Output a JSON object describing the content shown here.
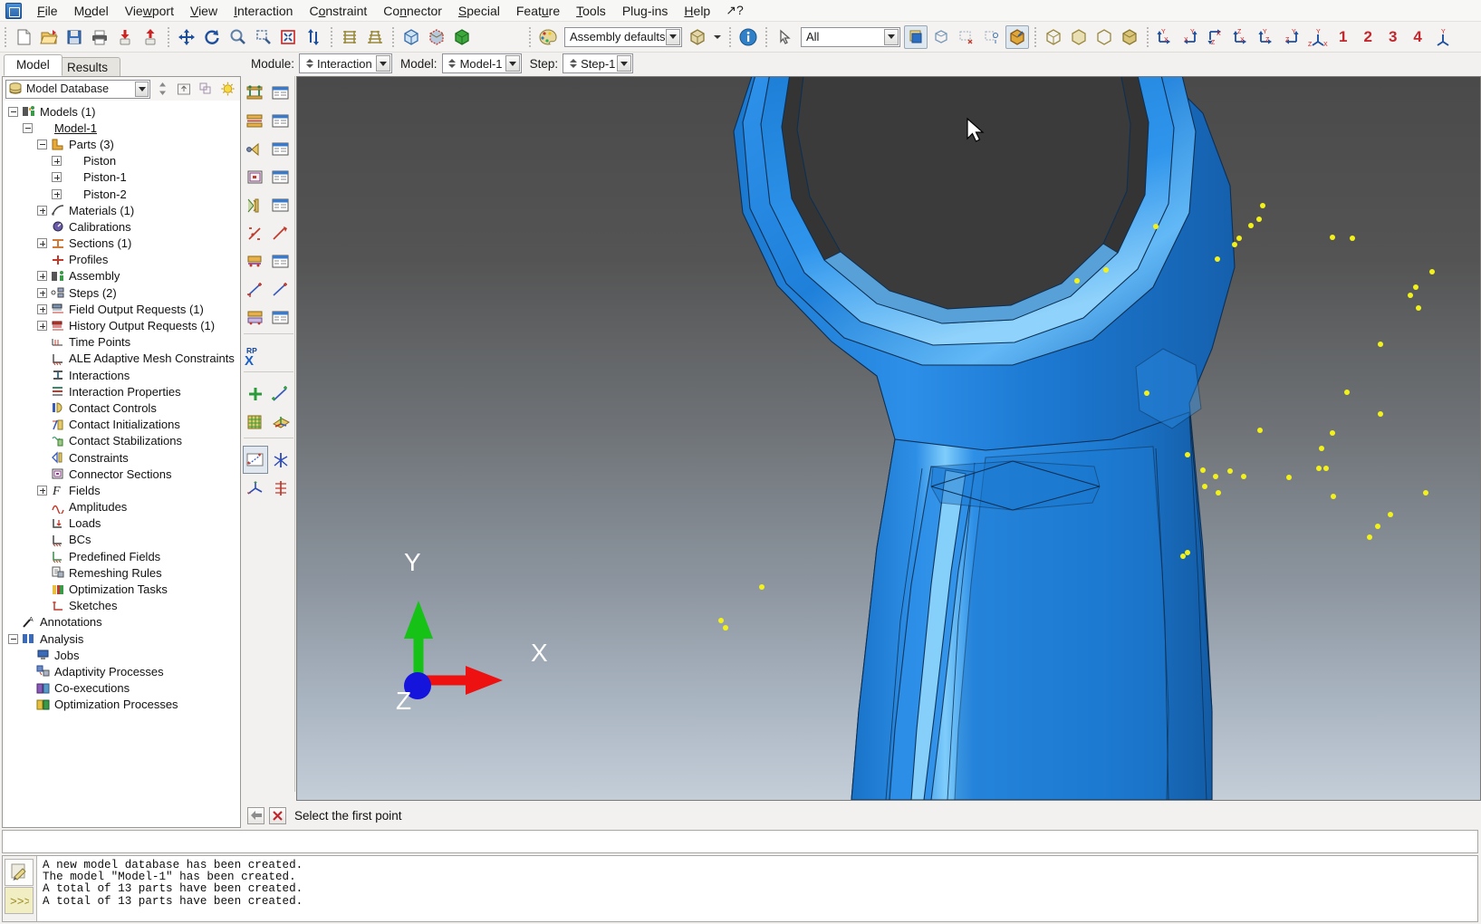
{
  "window": {
    "app_icon": "abaqus-cae-icon"
  },
  "menubar": {
    "items": [
      {
        "label": "File",
        "mnemonic": "F"
      },
      {
        "label": "Model",
        "mnemonic": "M"
      },
      {
        "label": "Viewport",
        "mnemonic": "w"
      },
      {
        "label": "View",
        "mnemonic": "V"
      },
      {
        "label": "Interaction",
        "mnemonic": "I"
      },
      {
        "label": "Constraint",
        "mnemonic": "o"
      },
      {
        "label": "Connector",
        "mnemonic": "n"
      },
      {
        "label": "Special",
        "mnemonic": "S"
      },
      {
        "label": "Feature",
        "mnemonic": "u"
      },
      {
        "label": "Tools",
        "mnemonic": "T"
      },
      {
        "label": "Plug-ins",
        "mnemonic": "g"
      },
      {
        "label": "Help",
        "mnemonic": "H"
      }
    ],
    "help_cursor": "context-help-icon"
  },
  "toolbar": {
    "file_group": [
      "new-file-icon",
      "open-file-icon",
      "save-icon",
      "print-icon",
      "import-icon",
      "export-icon"
    ],
    "view_group": [
      "pan-icon",
      "rotate-icon",
      "magnify-icon",
      "zoom-box-icon",
      "fit-all-icon",
      "auto-fit-icon"
    ],
    "render_group": [
      "wireframe-icon",
      "hidden-line-icon"
    ],
    "shade_group": [
      "shaded-cube-icon",
      "render-style-icon",
      "filled-cube-icon"
    ],
    "color_label": "Assembly defaults",
    "color_icon": "color-palette-icon",
    "color_cube_icon": "color-code-cube-icon",
    "info_icon": "info-icon",
    "select_arrow_icon": "selection-arrow-icon",
    "filter_value": "All",
    "display_group": [
      "display-group-icon",
      "replace-group-icon",
      "remove-selected-icon",
      "add-selected-icon",
      "reset-group-icon"
    ],
    "part_group": [
      "part-cube-icon",
      "instance-cube-icon",
      "assembly-cube-icon",
      "highlight-cube-icon"
    ],
    "view_cube_group": [
      "view-xy-icon",
      "view-yx-icon",
      "view-zx-icon",
      "view-zx2-icon",
      "view-yz-icon",
      "view-zy-icon",
      "iso-view-icon"
    ],
    "view_numbers": [
      "1",
      "2",
      "3",
      "4"
    ],
    "last_icon": "apply-view-icon"
  },
  "left_panel": {
    "tabs": [
      {
        "label": "Model",
        "active": true
      },
      {
        "label": "Results",
        "active": false
      }
    ],
    "database_selector": {
      "value": "Model Database",
      "icon": "database-icon"
    },
    "tools": [
      "sort-icon",
      "up-level-icon",
      "filter-icon",
      "highlight-bulb-icon"
    ]
  },
  "tree": {
    "items": [
      {
        "depth": 0,
        "exp": "minus",
        "icon": "models-icon",
        "label": "Models (1)"
      },
      {
        "depth": 1,
        "exp": "minus",
        "icon": "none",
        "label": "Model-1",
        "underline": true
      },
      {
        "depth": 2,
        "exp": "minus",
        "icon": "parts-icon",
        "label": "Parts (3)"
      },
      {
        "depth": 3,
        "exp": "plus",
        "icon": "none",
        "label": "Piston"
      },
      {
        "depth": 3,
        "exp": "plus",
        "icon": "none",
        "label": "Piston-1"
      },
      {
        "depth": 3,
        "exp": "plus",
        "icon": "none",
        "label": "Piston-2"
      },
      {
        "depth": 2,
        "exp": "plus",
        "icon": "materials-icon",
        "label": "Materials (1)"
      },
      {
        "depth": 2,
        "exp": "leaf",
        "icon": "calibrations-icon",
        "label": "Calibrations"
      },
      {
        "depth": 2,
        "exp": "plus",
        "icon": "sections-icon",
        "label": "Sections (1)"
      },
      {
        "depth": 2,
        "exp": "leaf",
        "icon": "profiles-icon",
        "label": "Profiles"
      },
      {
        "depth": 2,
        "exp": "plus",
        "icon": "assembly-icon",
        "label": "Assembly"
      },
      {
        "depth": 2,
        "exp": "plus",
        "icon": "steps-icon",
        "label": "Steps (2)"
      },
      {
        "depth": 2,
        "exp": "plus",
        "icon": "field-output-icon",
        "label": "Field Output Requests (1)"
      },
      {
        "depth": 2,
        "exp": "plus",
        "icon": "history-output-icon",
        "label": "History Output Requests (1)"
      },
      {
        "depth": 2,
        "exp": "leaf",
        "icon": "time-points-icon",
        "label": "Time Points"
      },
      {
        "depth": 2,
        "exp": "leaf",
        "icon": "ale-mesh-icon",
        "label": "ALE Adaptive Mesh Constraints"
      },
      {
        "depth": 2,
        "exp": "leaf",
        "icon": "interactions-icon",
        "label": "Interactions"
      },
      {
        "depth": 2,
        "exp": "leaf",
        "icon": "interaction-props-icon",
        "label": "Interaction Properties"
      },
      {
        "depth": 2,
        "exp": "leaf",
        "icon": "contact-controls-icon",
        "label": "Contact Controls"
      },
      {
        "depth": 2,
        "exp": "leaf",
        "icon": "contact-init-icon",
        "label": "Contact Initializations"
      },
      {
        "depth": 2,
        "exp": "leaf",
        "icon": "contact-stab-icon",
        "label": "Contact Stabilizations"
      },
      {
        "depth": 2,
        "exp": "leaf",
        "icon": "constraints-icon",
        "label": "Constraints"
      },
      {
        "depth": 2,
        "exp": "leaf",
        "icon": "connector-sections-icon",
        "label": "Connector Sections"
      },
      {
        "depth": 2,
        "exp": "plus",
        "icon": "fields-icon",
        "label": "Fields"
      },
      {
        "depth": 2,
        "exp": "leaf",
        "icon": "amplitudes-icon",
        "label": "Amplitudes"
      },
      {
        "depth": 2,
        "exp": "leaf",
        "icon": "loads-icon",
        "label": "Loads"
      },
      {
        "depth": 2,
        "exp": "leaf",
        "icon": "bcs-icon",
        "label": "BCs"
      },
      {
        "depth": 2,
        "exp": "leaf",
        "icon": "predefined-fields-icon",
        "label": "Predefined Fields"
      },
      {
        "depth": 2,
        "exp": "leaf",
        "icon": "remeshing-rules-icon",
        "label": "Remeshing Rules"
      },
      {
        "depth": 2,
        "exp": "leaf",
        "icon": "optimization-tasks-icon",
        "label": "Optimization Tasks"
      },
      {
        "depth": 2,
        "exp": "leaf",
        "icon": "sketches-icon",
        "label": "Sketches"
      },
      {
        "depth": 0,
        "exp": "leaf",
        "icon": "annotations-icon",
        "label": "Annotations"
      },
      {
        "depth": 0,
        "exp": "minus",
        "icon": "analysis-icon",
        "label": "Analysis"
      },
      {
        "depth": 1,
        "exp": "leaf",
        "icon": "jobs-icon",
        "label": "Jobs"
      },
      {
        "depth": 1,
        "exp": "leaf",
        "icon": "adaptivity-icon",
        "label": "Adaptivity Processes"
      },
      {
        "depth": 1,
        "exp": "leaf",
        "icon": "coexecutions-icon",
        "label": "Co-executions"
      },
      {
        "depth": 1,
        "exp": "leaf",
        "icon": "optimization-proc-icon",
        "label": "Optimization Processes"
      }
    ]
  },
  "context_bar": {
    "module_label": "Module:",
    "module_value": "Interaction",
    "model_label": "Model:",
    "model_value": "Model-1",
    "step_label": "Step:",
    "step_value": "Step-1"
  },
  "toolbox": {
    "items": [
      "create-interaction-icon",
      "interaction-manager-icon",
      "create-interaction-property-icon",
      "interaction-property-manager-icon",
      "create-constraint-icon",
      "constraint-manager-icon",
      "create-connector-section-icon",
      "connector-section-manager-icon",
      "create-contact-control-icon",
      "contact-control-manager-icon",
      "create-contact-initialization-icon",
      "contact-initialization-manager-icon",
      "create-contact-stabilization-icon",
      "contact-stabilization-manager-icon",
      "create-wire-feature-icon",
      "edit-wire-feature-icon",
      "find-contact-pairs-icon",
      "connector-manager-icon",
      "reference-point-icon",
      "create-datum-point-icon",
      "create-datum-axis-icon",
      "create-datum-plane-icon",
      "create-datum-csys-icon",
      "partition-face-sketch-icon",
      "partition-cell-icon",
      "partition-edge-icon",
      "partition-datum-icon"
    ],
    "selected": "partition-face-sketch-icon"
  },
  "viewport": {
    "triad": {
      "x_label": "X",
      "y_label": "Y",
      "z_label": "Z",
      "x_color": "#ee1111",
      "y_color": "#16c216",
      "z_color": "#1414dd"
    },
    "part_color": "#1a7fdd",
    "node_color": "#f2f21a",
    "background_top": "#4c4c4c",
    "background_bottom": "#c3cdd8",
    "cursor": "arrow-cursor"
  },
  "prompt": {
    "back_icon": "previous-step-icon",
    "cancel_icon": "cancel-icon",
    "text": "Select the first point"
  },
  "message_area": {
    "tabs": [
      {
        "name": "message-log-tab",
        "icon": "message-pad-icon",
        "active": true
      },
      {
        "name": "kernel-command-tab",
        "icon": "kernel-prompt-icon",
        "active": false
      }
    ],
    "lines": [
      "A new model database has been created.",
      "The model \"Model-1\" has been created.",
      "A total of 13 parts have been created.",
      "A total of 13 parts have been created."
    ]
  }
}
